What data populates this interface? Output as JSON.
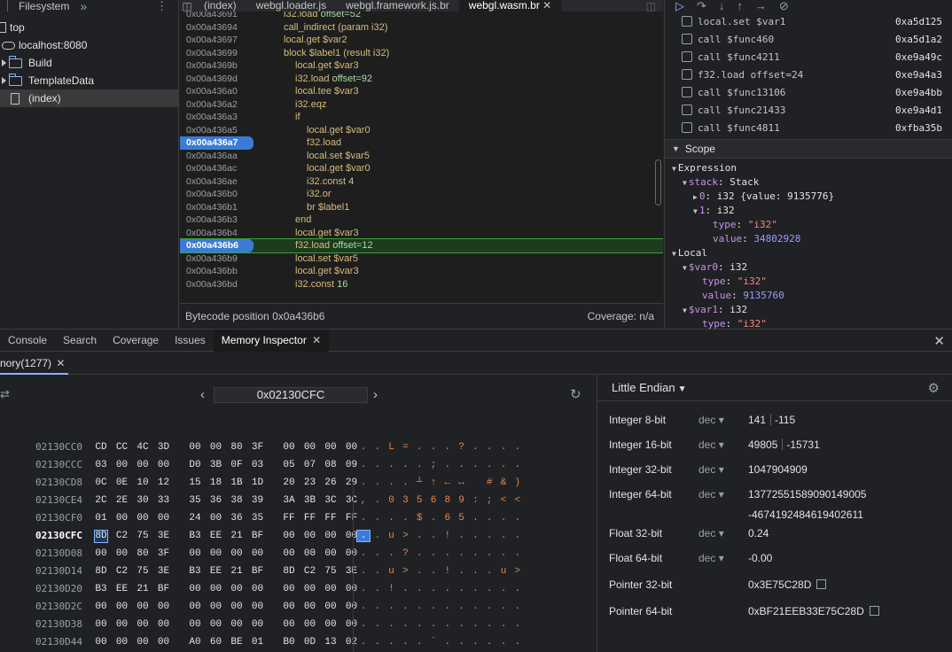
{
  "navigator": {
    "tabs": [
      "Filesystem"
    ],
    "more": "»",
    "tree": [
      {
        "label": "top",
        "kind": "frame"
      },
      {
        "label": "localhost:8080",
        "kind": "origin"
      },
      {
        "label": "Build",
        "kind": "folder"
      },
      {
        "label": "TemplateData",
        "kind": "folder"
      },
      {
        "label": "(index)",
        "kind": "file",
        "selected": true
      }
    ]
  },
  "editor": {
    "tabs": [
      {
        "label": "(index)",
        "active": false
      },
      {
        "label": "webgl.loader.js",
        "active": false
      },
      {
        "label": "webgl.framework.js.br",
        "active": false
      },
      {
        "label": "webgl.wasm.br",
        "active": true
      }
    ],
    "lines": [
      {
        "addr": "0x00a43691",
        "code": "i32.load offset=52",
        "indent": 0
      },
      {
        "addr": "0x00a43694",
        "code": "call_indirect (param i32)",
        "indent": 0
      },
      {
        "addr": "0x00a43697",
        "code": "local.get $var2",
        "indent": 0
      },
      {
        "addr": "0x00a43699",
        "code": "block $label1 (result i32)",
        "indent": 0
      },
      {
        "addr": "0x00a4369b",
        "code": "local.get $var3",
        "indent": 1
      },
      {
        "addr": "0x00a4369d",
        "code": "i32.load offset=92",
        "indent": 1
      },
      {
        "addr": "0x00a436a0",
        "code": "local.tee $var3",
        "indent": 1
      },
      {
        "addr": "0x00a436a2",
        "code": "i32.eqz",
        "indent": 1
      },
      {
        "addr": "0x00a436a3",
        "code": "if",
        "indent": 1
      },
      {
        "addr": "0x00a436a5",
        "code": "local.get $var0",
        "indent": 2
      },
      {
        "addr": "0x00a436a7",
        "code": "f32.load",
        "indent": 2,
        "breakpoint": true
      },
      {
        "addr": "0x00a436aa",
        "code": "local.set $var5",
        "indent": 2
      },
      {
        "addr": "0x00a436ac",
        "code": "local.get $var0",
        "indent": 2
      },
      {
        "addr": "0x00a436ae",
        "code": "i32.const 4",
        "indent": 2
      },
      {
        "addr": "0x00a436b0",
        "code": "i32.or",
        "indent": 2
      },
      {
        "addr": "0x00a436b1",
        "code": "br $label1",
        "indent": 2
      },
      {
        "addr": "0x00a436b3",
        "code": "end",
        "indent": 1
      },
      {
        "addr": "0x00a436b4",
        "code": "local.get $var3",
        "indent": 1
      },
      {
        "addr": "0x00a436b6",
        "code": "f32.load offset=12",
        "indent": 1,
        "breakpoint": true,
        "current": true
      },
      {
        "addr": "0x00a436b9",
        "code": "local.set $var5",
        "indent": 1
      },
      {
        "addr": "0x00a436bb",
        "code": "local.get $var3",
        "indent": 1
      },
      {
        "addr": "0x00a436bd",
        "code": "i32.const 16",
        "indent": 1
      }
    ],
    "status_left": "Bytecode position 0x0a436b6",
    "status_right": "Coverage: n/a"
  },
  "debugger": {
    "call_stack": [
      {
        "name": "local.set $var1",
        "addr": "0xa5d125"
      },
      {
        "name": "call $func460",
        "addr": "0xa5d1a2"
      },
      {
        "name": "call $func4211",
        "addr": "0xe9a49c"
      },
      {
        "name": "f32.load offset=24",
        "addr": "0xe9a4a3"
      },
      {
        "name": "call $func13106",
        "addr": "0xe9a4bb"
      },
      {
        "name": "call $func21433",
        "addr": "0xe9a4d1"
      },
      {
        "name": "call $func4811",
        "addr": "0xfba35b"
      }
    ],
    "scope_title": "Scope",
    "scope": [
      {
        "indent": 0,
        "arrow": "▼",
        "key": "Expression",
        "plain": true
      },
      {
        "indent": 1,
        "arrow": "▼",
        "key": "stack",
        "val": "Stack"
      },
      {
        "indent": 2,
        "arrow": "▶",
        "key": "0",
        "val": "i32 {value: 9135776}"
      },
      {
        "indent": 2,
        "arrow": "▼",
        "key": "1",
        "val": "i32"
      },
      {
        "indent": 3,
        "arrow": "",
        "key": "type",
        "str": "\"i32\""
      },
      {
        "indent": 3,
        "arrow": "",
        "key": "value",
        "num": "34802928"
      },
      {
        "indent": 0,
        "arrow": "▼",
        "key": "Local",
        "plain": true
      },
      {
        "indent": 1,
        "arrow": "▼",
        "key": "$var0",
        "val": "i32"
      },
      {
        "indent": 2,
        "arrow": "",
        "key": "type",
        "str": "\"i32\""
      },
      {
        "indent": 2,
        "arrow": "",
        "key": "value",
        "num": "9135760"
      },
      {
        "indent": 1,
        "arrow": "▼",
        "key": "$var1",
        "val": "i32"
      },
      {
        "indent": 2,
        "arrow": "",
        "key": "type",
        "str": "\"i32\""
      }
    ]
  },
  "drawer": {
    "tabs": [
      {
        "label": "Console",
        "active": false
      },
      {
        "label": "Search",
        "active": false
      },
      {
        "label": "Coverage",
        "active": false
      },
      {
        "label": "Issues",
        "active": false
      },
      {
        "label": "Memory Inspector",
        "active": true,
        "closable": true
      }
    ],
    "memory_tab": "nory(1277)",
    "address": "0x02130CFC",
    "rows": [
      {
        "addr": "02130CC0",
        "bytes": [
          "CD",
          "CC",
          "4C",
          "3D",
          "00",
          "00",
          "80",
          "3F",
          "00",
          "00",
          "00",
          "00"
        ],
        "chars": [
          ".",
          ".",
          "L",
          "=",
          ".",
          ".",
          ".",
          "?",
          ".",
          ".",
          ".",
          "."
        ]
      },
      {
        "addr": "02130CCC",
        "bytes": [
          "03",
          "00",
          "00",
          "00",
          "D0",
          "3B",
          "0F",
          "03",
          "05",
          "07",
          "08",
          "09"
        ],
        "chars": [
          ".",
          ".",
          ".",
          ".",
          ".",
          ";",
          ".",
          ".",
          ".",
          ".",
          ".",
          "."
        ]
      },
      {
        "addr": "02130CD8",
        "bytes": [
          "0C",
          "0E",
          "10",
          "12",
          "15",
          "18",
          "1B",
          "1D",
          "20",
          "23",
          "26",
          "29"
        ],
        "chars": [
          ".",
          ".",
          ".",
          ".",
          "┴",
          "↑",
          "←",
          "↔",
          " ",
          "#",
          "&",
          ")"
        ]
      },
      {
        "addr": "02130CE4",
        "bytes": [
          "2C",
          "2E",
          "30",
          "33",
          "35",
          "36",
          "38",
          "39",
          "3A",
          "3B",
          "3C",
          "3C"
        ],
        "chars": [
          ",",
          ".",
          "0",
          "3",
          "5",
          "6",
          "8",
          "9",
          ":",
          ";",
          "<",
          "<"
        ]
      },
      {
        "addr": "02130CF0",
        "bytes": [
          "01",
          "00",
          "00",
          "00",
          "24",
          "00",
          "36",
          "35",
          "FF",
          "FF",
          "FF",
          "FF"
        ],
        "chars": [
          ".",
          ".",
          ".",
          ".",
          "$",
          ".",
          "6",
          "5",
          ".",
          ".",
          ".",
          "."
        ]
      },
      {
        "addr": "02130CFC",
        "bytes": [
          "8D",
          "C2",
          "75",
          "3E",
          "B3",
          "EE",
          "21",
          "BF",
          "00",
          "00",
          "00",
          "00"
        ],
        "chars": [
          ".",
          ".",
          "u",
          ">",
          ".",
          ".",
          "!",
          ".",
          ".",
          ".",
          ".",
          "."
        ],
        "current": true
      },
      {
        "addr": "02130D08",
        "bytes": [
          "00",
          "00",
          "80",
          "3F",
          "00",
          "00",
          "00",
          "00",
          "00",
          "00",
          "00",
          "00"
        ],
        "chars": [
          ".",
          ".",
          ".",
          "?",
          ".",
          ".",
          ".",
          ".",
          ".",
          ".",
          ".",
          "."
        ]
      },
      {
        "addr": "02130D14",
        "bytes": [
          "8D",
          "C2",
          "75",
          "3E",
          "B3",
          "EE",
          "21",
          "BF",
          "8D",
          "C2",
          "75",
          "3E"
        ],
        "chars": [
          ".",
          ".",
          "u",
          ">",
          ".",
          ".",
          "!",
          ".",
          ".",
          ".",
          "u",
          ">"
        ]
      },
      {
        "addr": "02130D20",
        "bytes": [
          "B3",
          "EE",
          "21",
          "BF",
          "00",
          "00",
          "00",
          "00",
          "00",
          "00",
          "00",
          "00"
        ],
        "chars": [
          ".",
          ".",
          "!",
          ".",
          ".",
          ".",
          ".",
          ".",
          ".",
          ".",
          ".",
          "."
        ]
      },
      {
        "addr": "02130D2C",
        "bytes": [
          "00",
          "00",
          "00",
          "00",
          "00",
          "00",
          "00",
          "00",
          "00",
          "00",
          "00",
          "00"
        ],
        "chars": [
          ".",
          ".",
          ".",
          ".",
          ".",
          ".",
          ".",
          ".",
          ".",
          ".",
          ".",
          "."
        ]
      },
      {
        "addr": "02130D38",
        "bytes": [
          "00",
          "00",
          "00",
          "00",
          "00",
          "00",
          "00",
          "00",
          "00",
          "00",
          "00",
          "00"
        ],
        "chars": [
          ".",
          ".",
          ".",
          ".",
          ".",
          ".",
          ".",
          ".",
          ".",
          ".",
          ".",
          "."
        ]
      },
      {
        "addr": "02130D44",
        "bytes": [
          "00",
          "00",
          "00",
          "00",
          "A0",
          "60",
          "BE",
          "01",
          "B0",
          "0D",
          "13",
          "02"
        ],
        "chars": [
          ".",
          ".",
          ".",
          ".",
          ".",
          "`",
          ".",
          ".",
          ".",
          ".",
          ".",
          "."
        ]
      }
    ],
    "endianness": "Little Endian",
    "values": [
      {
        "label": "Integer 8-bit",
        "mode": "dec",
        "val": "141",
        "val2": "-115"
      },
      {
        "label": "Integer 16-bit",
        "mode": "dec",
        "val": "49805",
        "val2": "-15731"
      },
      {
        "label": "Integer 32-bit",
        "mode": "dec",
        "val": "1047904909"
      },
      {
        "label": "Integer 64-bit",
        "mode": "dec",
        "val": "13772551589090149005",
        "extra": "-4674192484619402611"
      },
      {
        "label": "Float 32-bit",
        "mode": "dec",
        "val": "0.24"
      },
      {
        "label": "Float 64-bit",
        "mode": "dec",
        "val": "-0.00"
      },
      {
        "label": "Pointer 32-bit",
        "mode": "",
        "val": "0x3E75C28D",
        "link": true
      },
      {
        "label": "Pointer 64-bit",
        "mode": "",
        "val": "0xBF21EEB33E75C28D",
        "link": true
      }
    ]
  }
}
